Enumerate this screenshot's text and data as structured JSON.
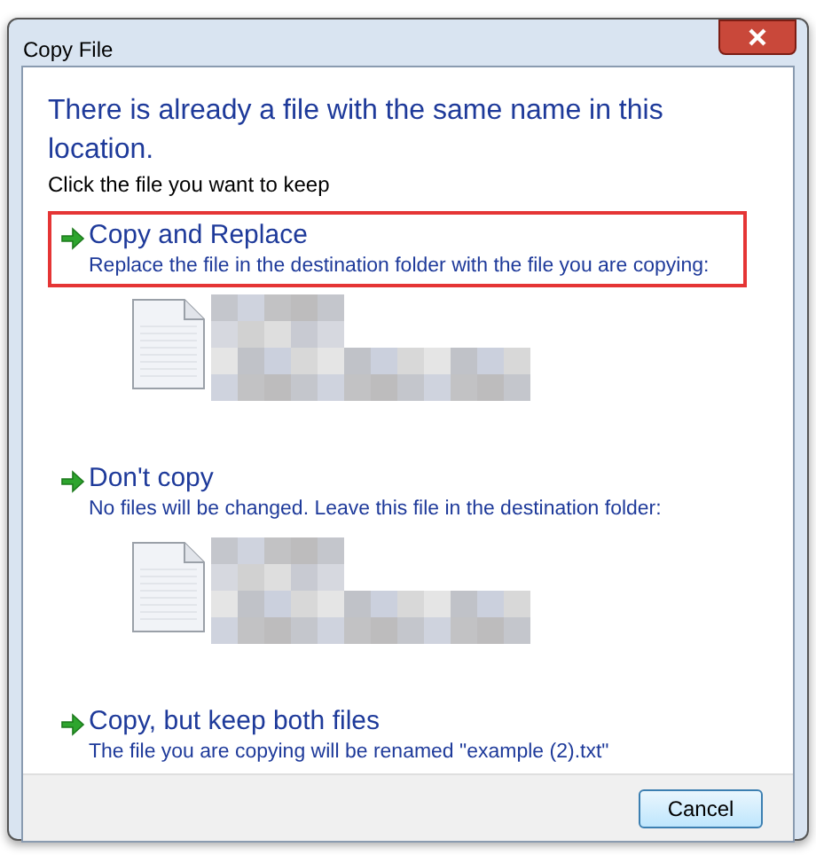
{
  "window": {
    "title": "Copy File"
  },
  "heading": "There is already a file with the same name in this location.",
  "instruction": "Click the file you want to keep",
  "options": [
    {
      "kind": "file",
      "title": "Copy and Replace",
      "description": "Replace the file in the destination folder with the file you are copying:",
      "highlighted": true
    },
    {
      "kind": "file",
      "title": "Don't copy",
      "description": "No files will be changed. Leave this file in the destination folder:",
      "highlighted": false
    },
    {
      "kind": "plain",
      "title": "Copy, but keep both files",
      "description": "The file you are copying will be renamed \"example (2).txt\"",
      "highlighted": false
    }
  ],
  "buttons": [
    "Cancel"
  ]
}
